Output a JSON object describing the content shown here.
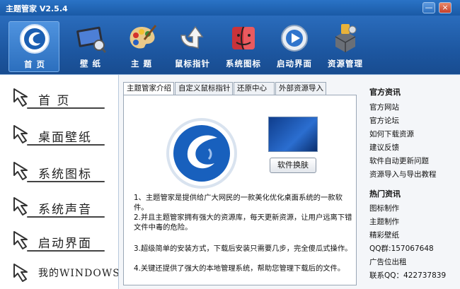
{
  "window": {
    "title": "主题管家 V2.5.4",
    "min_glyph": "—",
    "close_glyph": "×"
  },
  "toolbar": {
    "items": [
      {
        "label": "首 页",
        "icon": "home-swirl-icon",
        "active": true
      },
      {
        "label": "壁 纸",
        "icon": "wallpaper-monitor-icon"
      },
      {
        "label": "主 题",
        "icon": "palette-icon"
      },
      {
        "label": "鼠标指针",
        "icon": "cursor-arrow-icon"
      },
      {
        "label": "系统图标",
        "icon": "finder-face-icon"
      },
      {
        "label": "启动界面",
        "icon": "media-play-icon"
      },
      {
        "label": "资源管理",
        "icon": "resource-box-icon"
      }
    ]
  },
  "leftnav": {
    "items": [
      {
        "label": "首 页"
      },
      {
        "label": "桌面壁纸"
      },
      {
        "label": "系统图标"
      },
      {
        "label": "系统声音"
      },
      {
        "label": "启动界面"
      },
      {
        "label": "我的WINDOWS"
      }
    ]
  },
  "tabs": [
    {
      "label": "主题管家介绍",
      "active": true
    },
    {
      "label": "自定义鼠标指针"
    },
    {
      "label": "还原中心"
    },
    {
      "label": "外部资源导入"
    }
  ],
  "panel": {
    "skin_button": "软件换肤",
    "paragraphs": [
      "1、主题管家是提供给广大网民的一款美化优化桌面系统的一款软件。",
      "2.并且主题管家拥有强大的资源库，每天更新资源，让用户远离下错文件中毒的危险。",
      "3.超级简单的安装方式，下载后安装只需要几步，完全傻瓜式操作。",
      "4.关键还提供了强大的本地管理系统，帮助您管理下载后的文件。"
    ]
  },
  "right": {
    "official_title": "官方资讯",
    "official_links": [
      "官方网站",
      "官方论坛",
      "如何下载资源",
      "建议反馈",
      "软件自动更新问题",
      "资源导入与导出教程"
    ],
    "hot_title": "热门资讯",
    "hot_links": [
      "图标制作",
      "主题制作",
      "精彩壁纸",
      "QQ群:157067648",
      "广告位出租",
      "联系QQ：422737839"
    ]
  },
  "colors": {
    "titlebar": "#1f5fa8",
    "accent": "#2c6fbe"
  }
}
